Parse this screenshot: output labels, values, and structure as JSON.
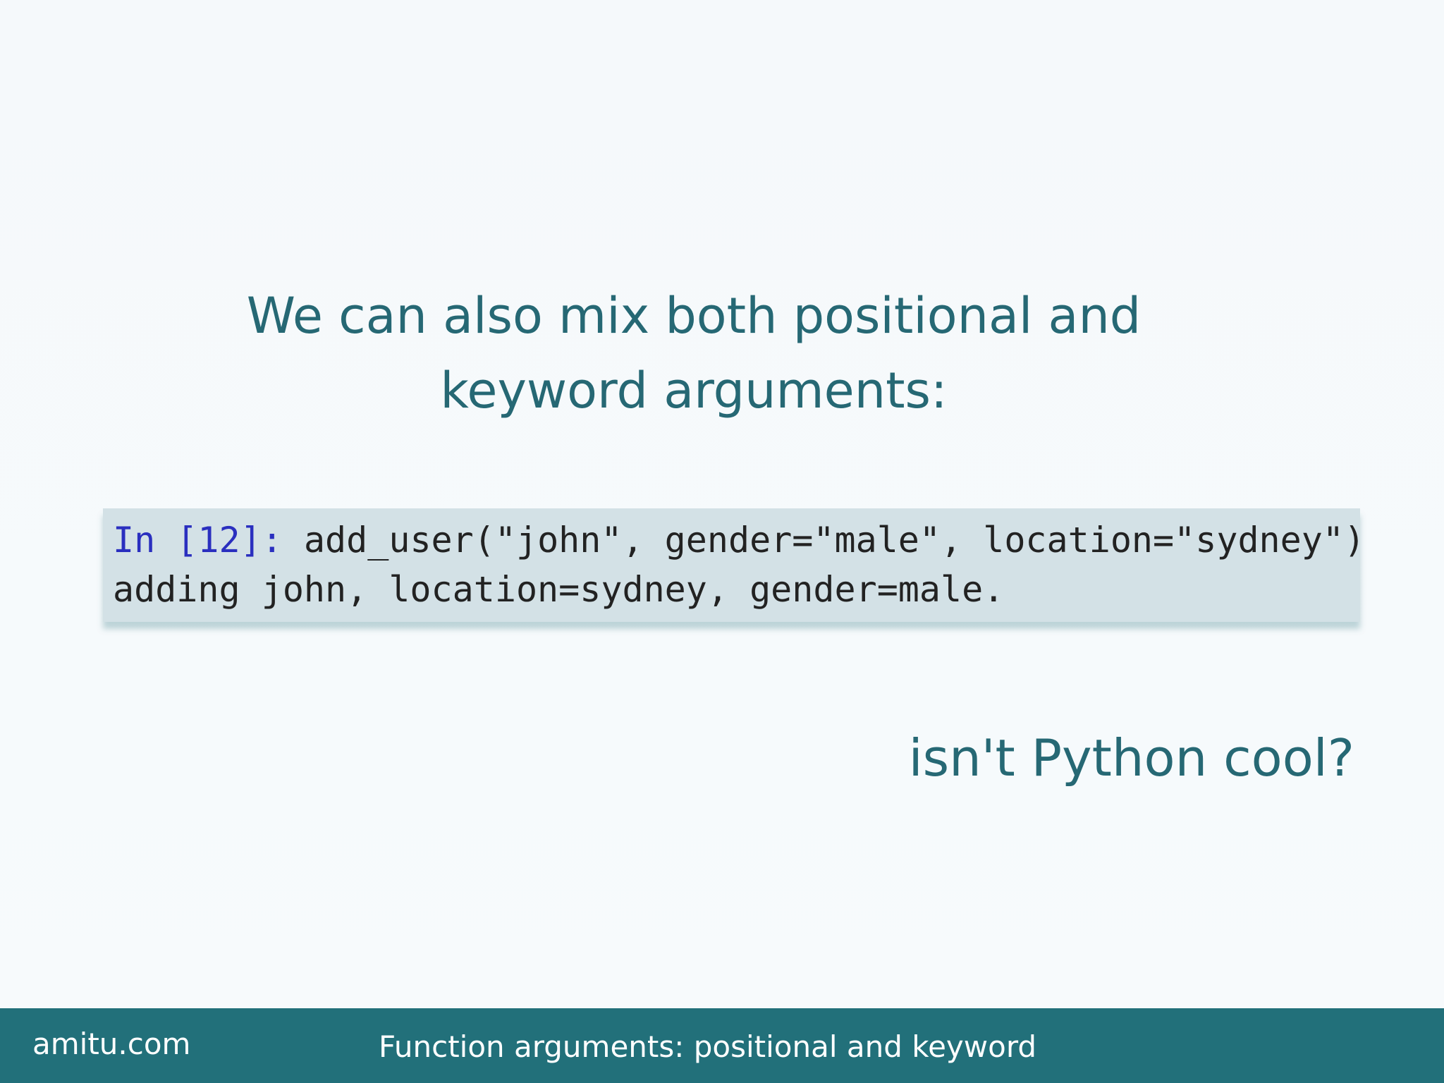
{
  "slide": {
    "heading_line1": "We can also mix both positional and",
    "heading_line2": "keyword arguments:",
    "code": {
      "prompt": "In [12]:",
      "input": "add_user(\"john\", gender=\"male\", location=\"sydney\")",
      "output": "adding john, location=sydney, gender=male."
    },
    "closing_text": "isn't Python cool?"
  },
  "footer": {
    "site": "amitu.com",
    "title": "Function arguments: positional and keyword"
  },
  "colors": {
    "heading_text": "#266874",
    "footer_background": "#22707a",
    "code_background": "#d3e1e6",
    "prompt_blue": "#2a2fbf"
  }
}
